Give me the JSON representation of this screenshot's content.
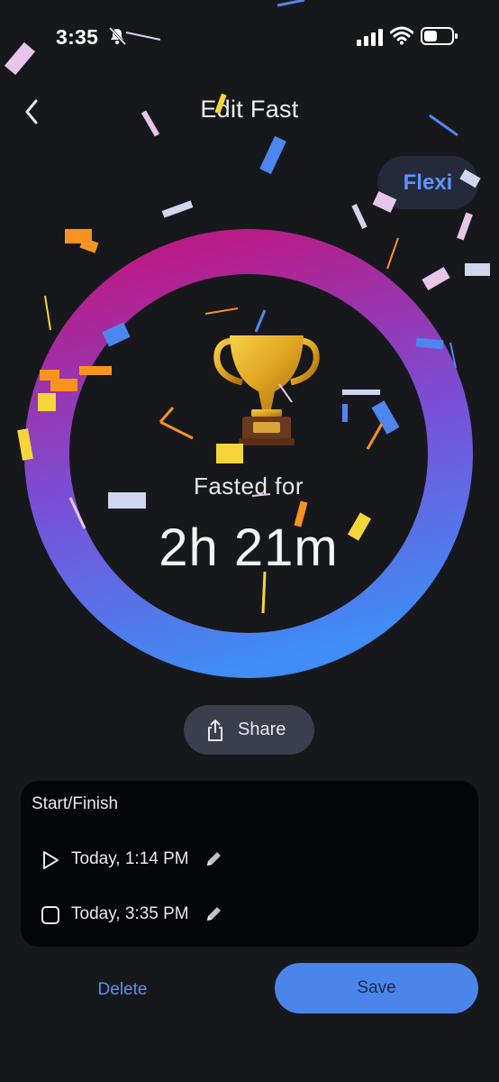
{
  "status_bar": {
    "time": "3:35",
    "icons": [
      "bell-muted-icon",
      "signal-icon",
      "wifi-icon",
      "battery-icon"
    ]
  },
  "header": {
    "back_icon": "chevron-left-icon",
    "title": "Edit Fast"
  },
  "plan_badge": {
    "label": "Flexi"
  },
  "progress_ring": {
    "icon": "trophy-icon",
    "label": "Fasted for",
    "duration": "2h 21m",
    "gradient_colors": [
      "#b81c88",
      "#7a4fd6",
      "#3f8df5"
    ]
  },
  "share": {
    "label": "Share",
    "icon": "share-icon"
  },
  "times": {
    "title": "Start/Finish",
    "start": {
      "icon": "play-icon",
      "value": "Today, 1:14 PM"
    },
    "finish": {
      "icon": "stop-icon",
      "value": "Today, 3:35 PM"
    },
    "edit_icon": "pencil-icon"
  },
  "actions": {
    "delete_label": "Delete",
    "save_label": "Save"
  },
  "colors": {
    "background": "#17181c",
    "accent": "#4a86ea",
    "card": "#030609"
  }
}
